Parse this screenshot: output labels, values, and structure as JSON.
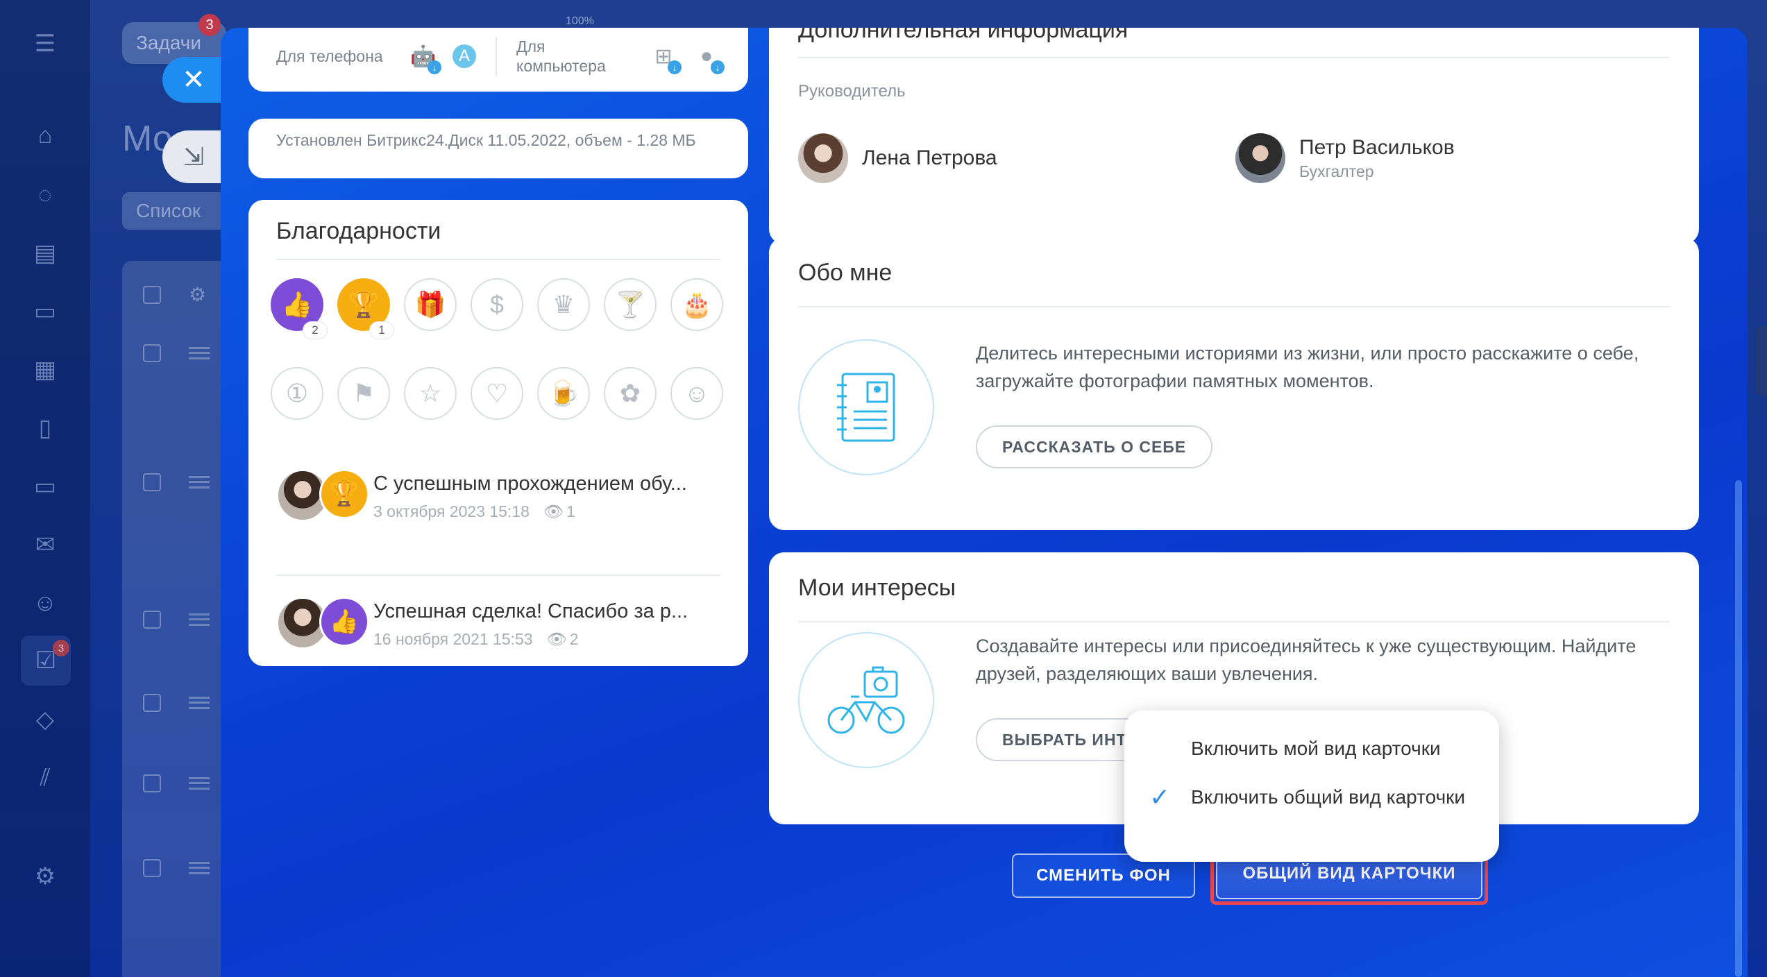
{
  "background": {
    "header_tab": "Задачи",
    "header_badge": "3",
    "zoom": "100%",
    "page_title": "Мо",
    "view_mode": "Список",
    "rail_badge": "3"
  },
  "apps": {
    "phone_label": "Для телефона",
    "computer_label": "Для компьютера"
  },
  "disk_info": "Установлен Битрикс24.Диск 11.05.2022, объем - 1.28 МБ",
  "thanks": {
    "title": "Благодарности",
    "like_count": "2",
    "cup_count": "1",
    "items": [
      {
        "text": "С успешным прохождением обу...",
        "date": "3 октября 2023 15:18",
        "views": "1"
      },
      {
        "text": "Успешная сделка! Спасибо за р...",
        "date": "16 ноября 2021 15:53",
        "views": "2"
      }
    ]
  },
  "info": {
    "title": "Дополнительная информация",
    "manager_label": "Руководитель",
    "manager": {
      "name": "Лена Петрова"
    },
    "colleague": {
      "name": "Петр Васильков",
      "role": "Бухгалтер"
    }
  },
  "about": {
    "title": "Обо мне",
    "text": "Делитесь интересными историями из жизни, или просто расскажите о себе, загружайте фотографии памятных моментов.",
    "button": "РАССКАЗАТЬ О СЕБЕ"
  },
  "interests": {
    "title": "Мои интересы",
    "text": "Создавайте интересы или присоединяйтесь к уже существующим. Найдите друзей, разделяющих ваши увлечения.",
    "button": "ВЫБРАТЬ ИНТЕРЕСЫ"
  },
  "popup": {
    "item_mine": "Включить мой вид карточки",
    "item_common": "Включить общий вид карточки"
  },
  "buttons": {
    "change_bg": "СМЕНИТЬ ФОН",
    "common_view": "ОБЩИЙ ВИД КАРТОЧКИ"
  },
  "colors": {
    "accent": "#2454d8",
    "highlight": "#e8474f",
    "like": "#7e4dd8",
    "cup": "#f6ad10"
  }
}
